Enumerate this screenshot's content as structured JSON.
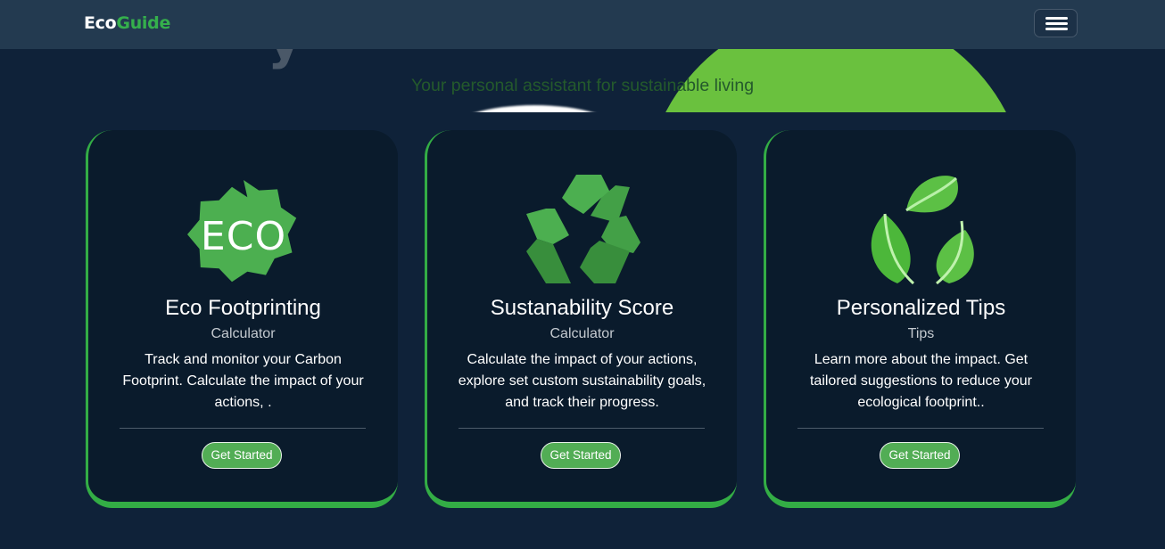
{
  "navbar": {
    "brand_eco": "Eco",
    "brand_guide": "Guide"
  },
  "hero": {
    "subtitle": "Your personal assistant for sustainable living"
  },
  "cards": [
    {
      "icon": "eco-badge-icon",
      "icon_text": "ECO",
      "title": "Eco Footprinting",
      "subtitle": "Calculator",
      "text": "Track  and monitor your Carbon Footprint. Calculate the impact of your actions, .",
      "button": "Get Started"
    },
    {
      "icon": "recycle-icon",
      "title": "Sustanability Score",
      "subtitle": "Calculator",
      "text": "Calculate the impact of your actions, explore set custom sustainability goals, and track their progress.",
      "button": "Get Started"
    },
    {
      "icon": "leaves-icon",
      "title": "Personalized Tips",
      "subtitle": "Tips",
      "text": "Learn more about the impact. Get tailored suggestions to reduce your ecological footprint..",
      "button": "Get Started"
    }
  ],
  "colors": {
    "background": "#0f2239",
    "navbar": "#233a50",
    "card": "#0a1b2c",
    "accent_green": "#33ad45",
    "button_green": "#52ad55"
  }
}
